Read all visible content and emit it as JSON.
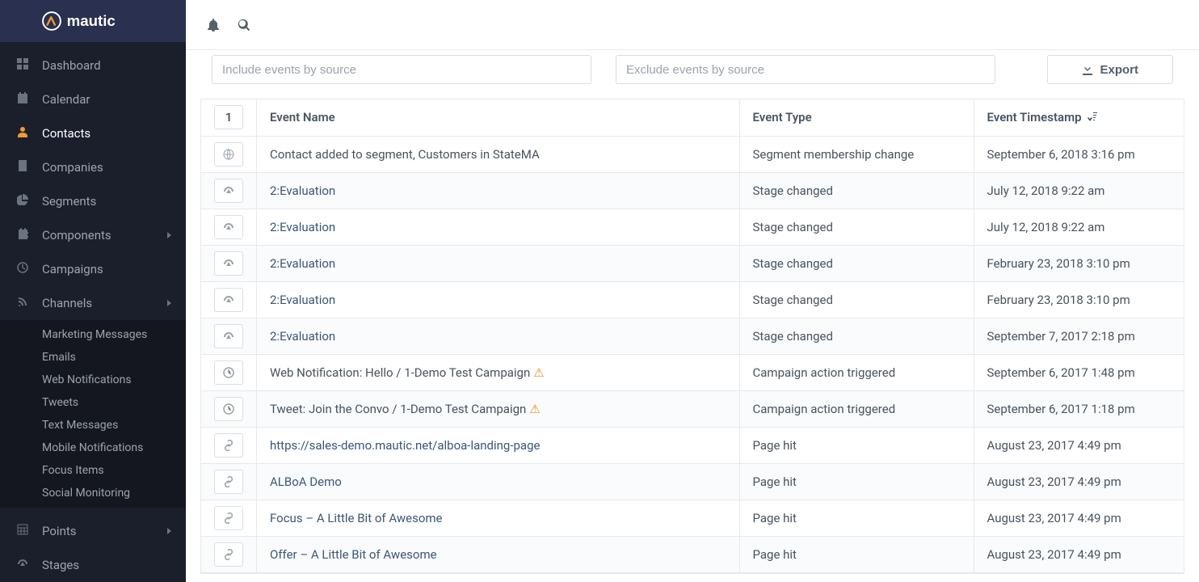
{
  "brand": "mautic",
  "topbar": {
    "bell_icon": "bell-icon",
    "search_icon": "search-icon"
  },
  "sidebar": {
    "items": [
      {
        "icon": "th-large",
        "label": "Dashboard",
        "active": false
      },
      {
        "icon": "calendar",
        "label": "Calendar",
        "active": false
      },
      {
        "icon": "user",
        "label": "Contacts",
        "active": true
      },
      {
        "icon": "building",
        "label": "Companies",
        "active": false
      },
      {
        "icon": "pie-chart",
        "label": "Segments",
        "active": false
      },
      {
        "icon": "puzzle",
        "label": "Components",
        "active": false,
        "caret": true
      },
      {
        "icon": "clock",
        "label": "Campaigns",
        "active": false
      },
      {
        "icon": "rss",
        "label": "Channels",
        "active": false,
        "caret": true
      }
    ],
    "channels_sub": [
      "Marketing Messages",
      "Emails",
      "Web Notifications",
      "Tweets",
      "Text Messages",
      "Mobile Notifications",
      "Focus Items",
      "Social Monitoring"
    ],
    "tail": [
      {
        "icon": "calc",
        "label": "Points",
        "caret": true
      },
      {
        "icon": "tach",
        "label": "Stages"
      }
    ]
  },
  "filters": {
    "include_placeholder": "Include events by source",
    "exclude_placeholder": "Exclude events by source",
    "export_label": "Export"
  },
  "table": {
    "count": "1",
    "headers": {
      "name": "Event Name",
      "type": "Event Type",
      "ts": "Event Timestamp"
    },
    "rows": [
      {
        "icon": "globe",
        "link": false,
        "name": "Contact added to segment, Customers in StateMA",
        "warn": false,
        "type": "Segment membership change",
        "ts": "September 6, 2018 3:16 pm"
      },
      {
        "icon": "tach",
        "link": true,
        "name": "2:Evaluation",
        "warn": false,
        "type": "Stage changed",
        "ts": "July 12, 2018 9:22 am"
      },
      {
        "icon": "tach",
        "link": true,
        "name": "2:Evaluation",
        "warn": false,
        "type": "Stage changed",
        "ts": "July 12, 2018 9:22 am"
      },
      {
        "icon": "tach",
        "link": true,
        "name": "2:Evaluation",
        "warn": false,
        "type": "Stage changed",
        "ts": "February 23, 2018 3:10 pm"
      },
      {
        "icon": "tach",
        "link": true,
        "name": "2:Evaluation",
        "warn": false,
        "type": "Stage changed",
        "ts": "February 23, 2018 3:10 pm"
      },
      {
        "icon": "tach",
        "link": true,
        "name": "2:Evaluation",
        "warn": false,
        "type": "Stage changed",
        "ts": "September 7, 2017 2:18 pm"
      },
      {
        "icon": "clock",
        "link": false,
        "name": "Web Notification: Hello / 1-Demo Test Campaign",
        "warn": true,
        "type": "Campaign action triggered",
        "ts": "September 6, 2017 1:48 pm"
      },
      {
        "icon": "clock",
        "link": false,
        "name": "Tweet: Join the Convo / 1-Demo Test Campaign",
        "warn": true,
        "type": "Campaign action triggered",
        "ts": "September 6, 2017 1:18 pm"
      },
      {
        "icon": "link",
        "link": true,
        "name": "https://sales-demo.mautic.net/alboa-landing-page",
        "warn": false,
        "type": "Page hit",
        "ts": "August 23, 2017 4:49 pm"
      },
      {
        "icon": "link",
        "link": true,
        "name": "ALBoA Demo",
        "warn": false,
        "type": "Page hit",
        "ts": "August 23, 2017 4:49 pm"
      },
      {
        "icon": "link",
        "link": true,
        "name": "Focus – A Little Bit of Awesome",
        "warn": false,
        "type": "Page hit",
        "ts": "August 23, 2017 4:49 pm"
      },
      {
        "icon": "link",
        "link": true,
        "name": "Offer – A Little Bit of Awesome",
        "warn": false,
        "type": "Page hit",
        "ts": "August 23, 2017 4:49 pm"
      }
    ]
  }
}
